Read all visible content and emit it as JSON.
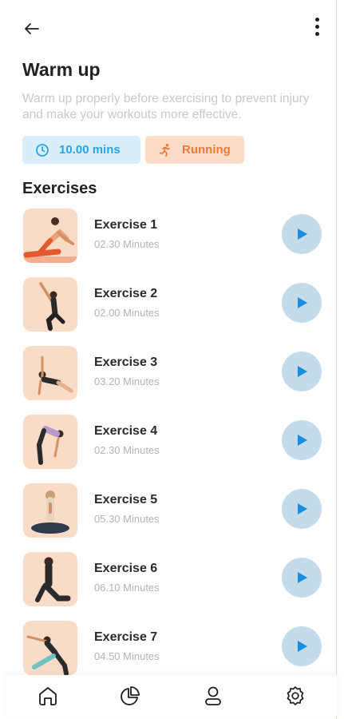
{
  "header": {
    "back_icon": "arrow-left-icon",
    "menu_icon": "more-vertical-icon"
  },
  "page": {
    "title": "Warm up",
    "description": "Warm up properly before exercising to prevent injury and make your workouts more effective."
  },
  "chips": {
    "duration": {
      "icon": "clock-icon",
      "label": "10.00 mins",
      "color": "#2aa5e2",
      "bg": "#d8eefb"
    },
    "activity": {
      "icon": "running-icon",
      "label": "Running",
      "color": "#f07b36",
      "bg": "#fbdcc8"
    }
  },
  "exercises_section": {
    "title": "Exercises",
    "items": [
      {
        "name": "Exercise 1",
        "duration": "02.30 Minutes"
      },
      {
        "name": "Exercise 2",
        "duration": "02.00 Minutes"
      },
      {
        "name": "Exercise 3",
        "duration": "03.20 Minutes"
      },
      {
        "name": "Exercise 4",
        "duration": "02.30 Minutes"
      },
      {
        "name": "Exercise 5",
        "duration": "05.30 Minutes"
      },
      {
        "name": "Exercise 6",
        "duration": "06.10 Minutes"
      },
      {
        "name": "Exercise 7",
        "duration": "04.50 Minutes"
      }
    ]
  },
  "bottom_nav": {
    "items": [
      "home-icon",
      "pie-chart-icon",
      "profile-icon",
      "settings-icon"
    ]
  },
  "colors": {
    "play_button": "#c4dbeb",
    "play_icon": "#1a8fe0",
    "thumb_bg": "#f9dcc7"
  }
}
